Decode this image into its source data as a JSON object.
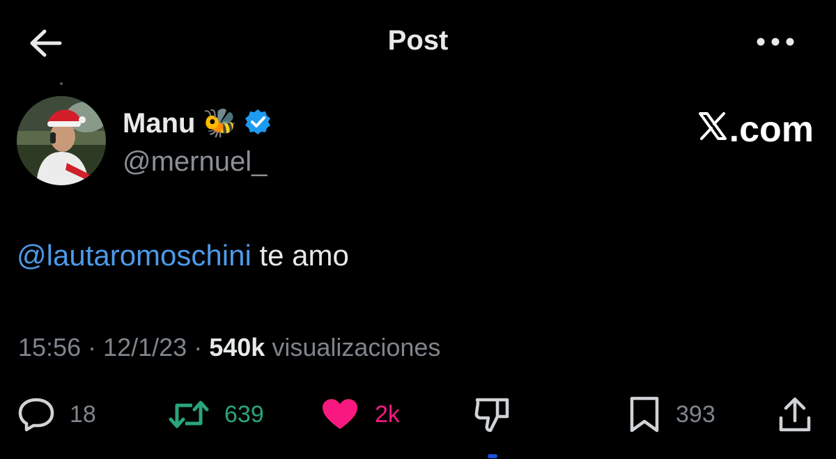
{
  "topbar": {
    "title": "Post"
  },
  "author": {
    "display_name": "Manu",
    "emoji": "🐝",
    "handle": "@mernuel_",
    "verified_color": "#1d9bf0"
  },
  "watermark": {
    "text": ".com"
  },
  "tweet": {
    "mention": "@lautaromoschini",
    "text": " te amo"
  },
  "meta": {
    "time": "15:56",
    "sep1": " · ",
    "date": "12/1/23",
    "sep2": " · ",
    "views_count": "540k",
    "views_label": " visualizaciones"
  },
  "actions": {
    "replies": "18",
    "reposts": "639",
    "likes": "2k",
    "bookmarks": "393"
  },
  "colors": {
    "background": "#000000",
    "mention": "#4d9ae8",
    "repost": "#2aa57a",
    "like": "#f91880",
    "muted": "#7f858b"
  }
}
